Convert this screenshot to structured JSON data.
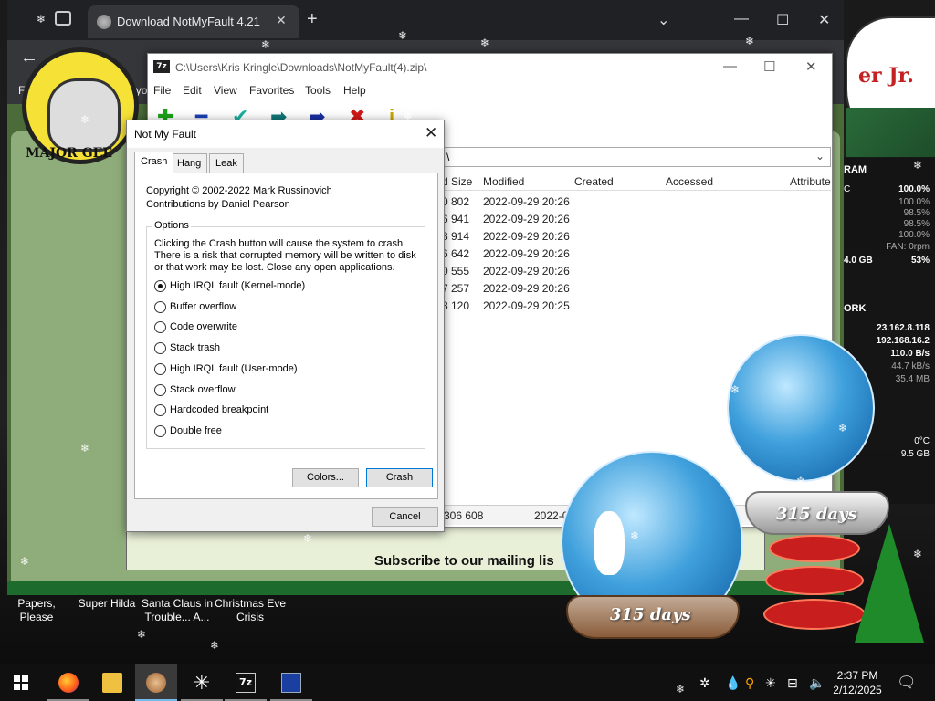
{
  "browser": {
    "tab_title": "Download NotMyFault 4.21",
    "bookmark_bar_text": "For quick access, place your"
  },
  "website": {
    "logo_text": "MAJOR GEE",
    "subscribe_text": "Subscribe to our mailing lis"
  },
  "sevenzip": {
    "title": "C:\\Users\\Kris Kringle\\Downloads\\NotMyFault(4).zip\\",
    "menu": [
      "File",
      "Edit",
      "View",
      "Favorites",
      "Tools",
      "Help"
    ],
    "path_value": "\\",
    "columns": [
      "d Size",
      "Modified",
      "Created",
      "Accessed",
      "Attribute"
    ],
    "rows": [
      {
        "size": "0 802",
        "modified": "2022-09-29 20:26"
      },
      {
        "size": "6 941",
        "modified": "2022-09-29 20:26"
      },
      {
        "size": "8 914",
        "modified": "2022-09-29 20:26"
      },
      {
        "size": "6 642",
        "modified": "2022-09-29 20:26"
      },
      {
        "size": "0 555",
        "modified": "2022-09-29 20:26"
      },
      {
        "size": "7 257",
        "modified": "2022-09-29 20:26"
      },
      {
        "size": "3 120",
        "modified": "2022-09-29 20:25"
      }
    ],
    "status_size": "306 608",
    "status_date": "2022-0"
  },
  "dialog": {
    "title": "Not My Fault",
    "tabs": [
      "Crash",
      "Hang",
      "Leak"
    ],
    "copyright": "Copyright © 2002-2022 Mark Russinovich",
    "contributions": "Contributions by Daniel Pearson",
    "options_label": "Options",
    "description": "Clicking the Crash button will cause the system to crash. There is a risk that corrupted memory will be written to disk or that work may be lost. Close any open applications.",
    "options": [
      {
        "label": "High IRQL fault (Kernel-mode)",
        "selected": true
      },
      {
        "label": "Buffer overflow",
        "selected": false
      },
      {
        "label": "Code overwrite",
        "selected": false
      },
      {
        "label": "Stack trash",
        "selected": false
      },
      {
        "label": "High IRQL fault (User-mode)",
        "selected": false
      },
      {
        "label": "Stack overflow",
        "selected": false
      },
      {
        "label": "Hardcoded breakpoint",
        "selected": false
      },
      {
        "label": "Double free",
        "selected": false
      }
    ],
    "colors_button": "Colors...",
    "crash_button": "Crash",
    "cancel_button": "Cancel"
  },
  "gadget": {
    "ram_title": "RAM",
    "ram_values": [
      "100.0%",
      "100.0%",
      "98.5%",
      "98.5%",
      "100.0%"
    ],
    "fan": "FAN: 0rpm",
    "mem": "4.0 GB",
    "mem_pct": "53%",
    "net_title": "ORK",
    "ip1": "23.162.8.118",
    "ip2": "192.168.16.2",
    "rate1": "110.0 B/s",
    "rate2": "44.7 kB/s",
    "rate3": "35.4 MB",
    "temp": "0°C",
    "disk": "9.5 GB",
    "prefix_c": "C"
  },
  "globes": {
    "left_days": "315 days",
    "right_days": "315 days"
  },
  "cloud_text": "er Jr.",
  "desktop_icons": [
    "Papers, Please",
    "Super Hilda",
    "Santa Claus in Trouble... A...",
    "Christmas Eve Crisis"
  ],
  "clock": {
    "time": "2:37 PM",
    "date": "2/12/2025"
  },
  "colors": {
    "accent": "#0078d7",
    "tree": "#1e8a2a",
    "globe": "#3fa0dc"
  }
}
